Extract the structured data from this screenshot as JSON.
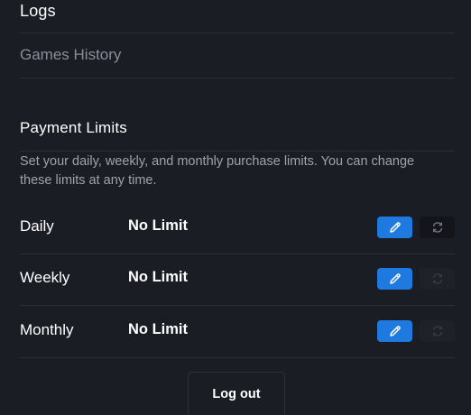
{
  "logs": {
    "heading": "Logs",
    "links": [
      {
        "label": "Games History"
      }
    ]
  },
  "payment_limits": {
    "title": "Payment Limits",
    "description": "Set your daily, weekly, and monthly purchase limits. You can change these limits at any time.",
    "rows": [
      {
        "label": "Daily",
        "value": "No Limit",
        "edit_icon": "pencil-icon",
        "reset_icon": "refresh-icon",
        "reset_enabled": true
      },
      {
        "label": "Weekly",
        "value": "No Limit",
        "edit_icon": "pencil-icon",
        "reset_icon": "refresh-icon",
        "reset_enabled": false
      },
      {
        "label": "Monthly",
        "value": "No Limit",
        "edit_icon": "pencil-icon",
        "reset_icon": "refresh-icon",
        "reset_enabled": false
      }
    ]
  },
  "account": {
    "logout_label": "Log out"
  },
  "colors": {
    "background": "#1b1d24",
    "accent": "#1f7ae0",
    "muted_text": "#8a8d99",
    "divider": "#2b2e37"
  }
}
